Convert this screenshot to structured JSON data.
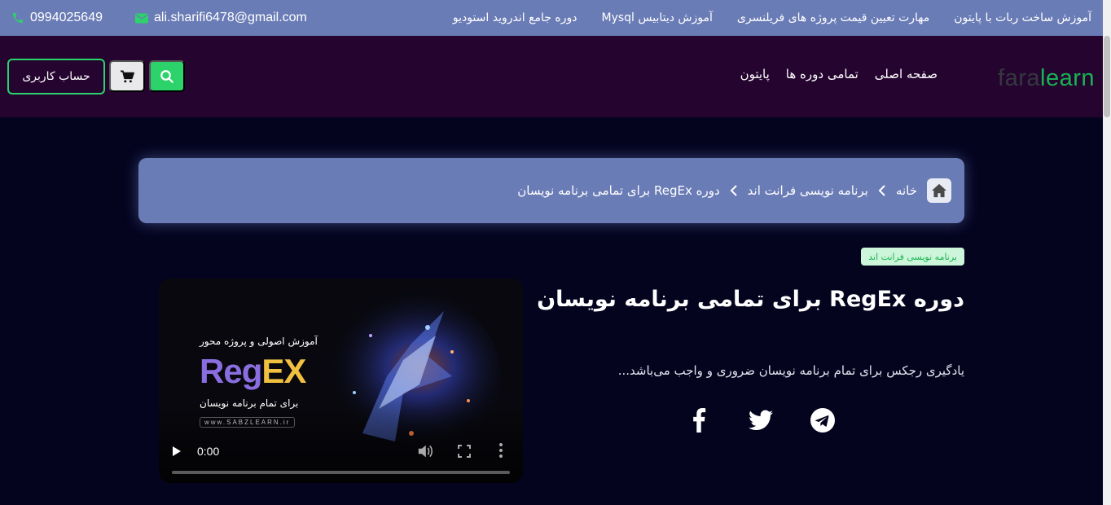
{
  "topbar": {
    "phone": "0994025649",
    "email": "ali.sharifi6478@gmail.com",
    "links": [
      "آموزش ساخت ربات با پایتون",
      "مهارت تعیین قیمت پروژه های فریلنسری",
      "آموزش دیتابیس Mysql",
      "دوره جامع اندروید استودیو"
    ]
  },
  "header": {
    "logo_part1": "fara",
    "logo_part2": "learn",
    "nav": [
      "صفحه اصلی",
      "تمامی دوره ها",
      "پایتون"
    ],
    "account_label": "حساب کاربری"
  },
  "breadcrumb": {
    "items": [
      "خانه",
      "برنامه نویسی فرانت اند",
      "دوره RegEx برای تمامی برنامه نویسان"
    ]
  },
  "course": {
    "category": "برنامه نویسی فرانت اند",
    "title": "دوره RegEx برای تمامی برنامه نویسان",
    "description": "یادگیری رجکس برای تمام برنامه نویسان ضروری و واجب می‌باشد..."
  },
  "video": {
    "promo_line1": "آموزش اصولی و پروژه محور",
    "promo_logo_reg": "Reg",
    "promo_logo_ex": "EX",
    "promo_line2": "برای تمام برنامه نویسان",
    "promo_site": "www.SABZLEARN.ir",
    "time": "0:00",
    "progress": 0
  },
  "socials": [
    "facebook-icon",
    "twitter-icon",
    "telegram-icon"
  ],
  "colors": {
    "topbar": "#6a7cb6",
    "header": "#250530",
    "page": "#04041f",
    "accent": "#2bd36a"
  }
}
